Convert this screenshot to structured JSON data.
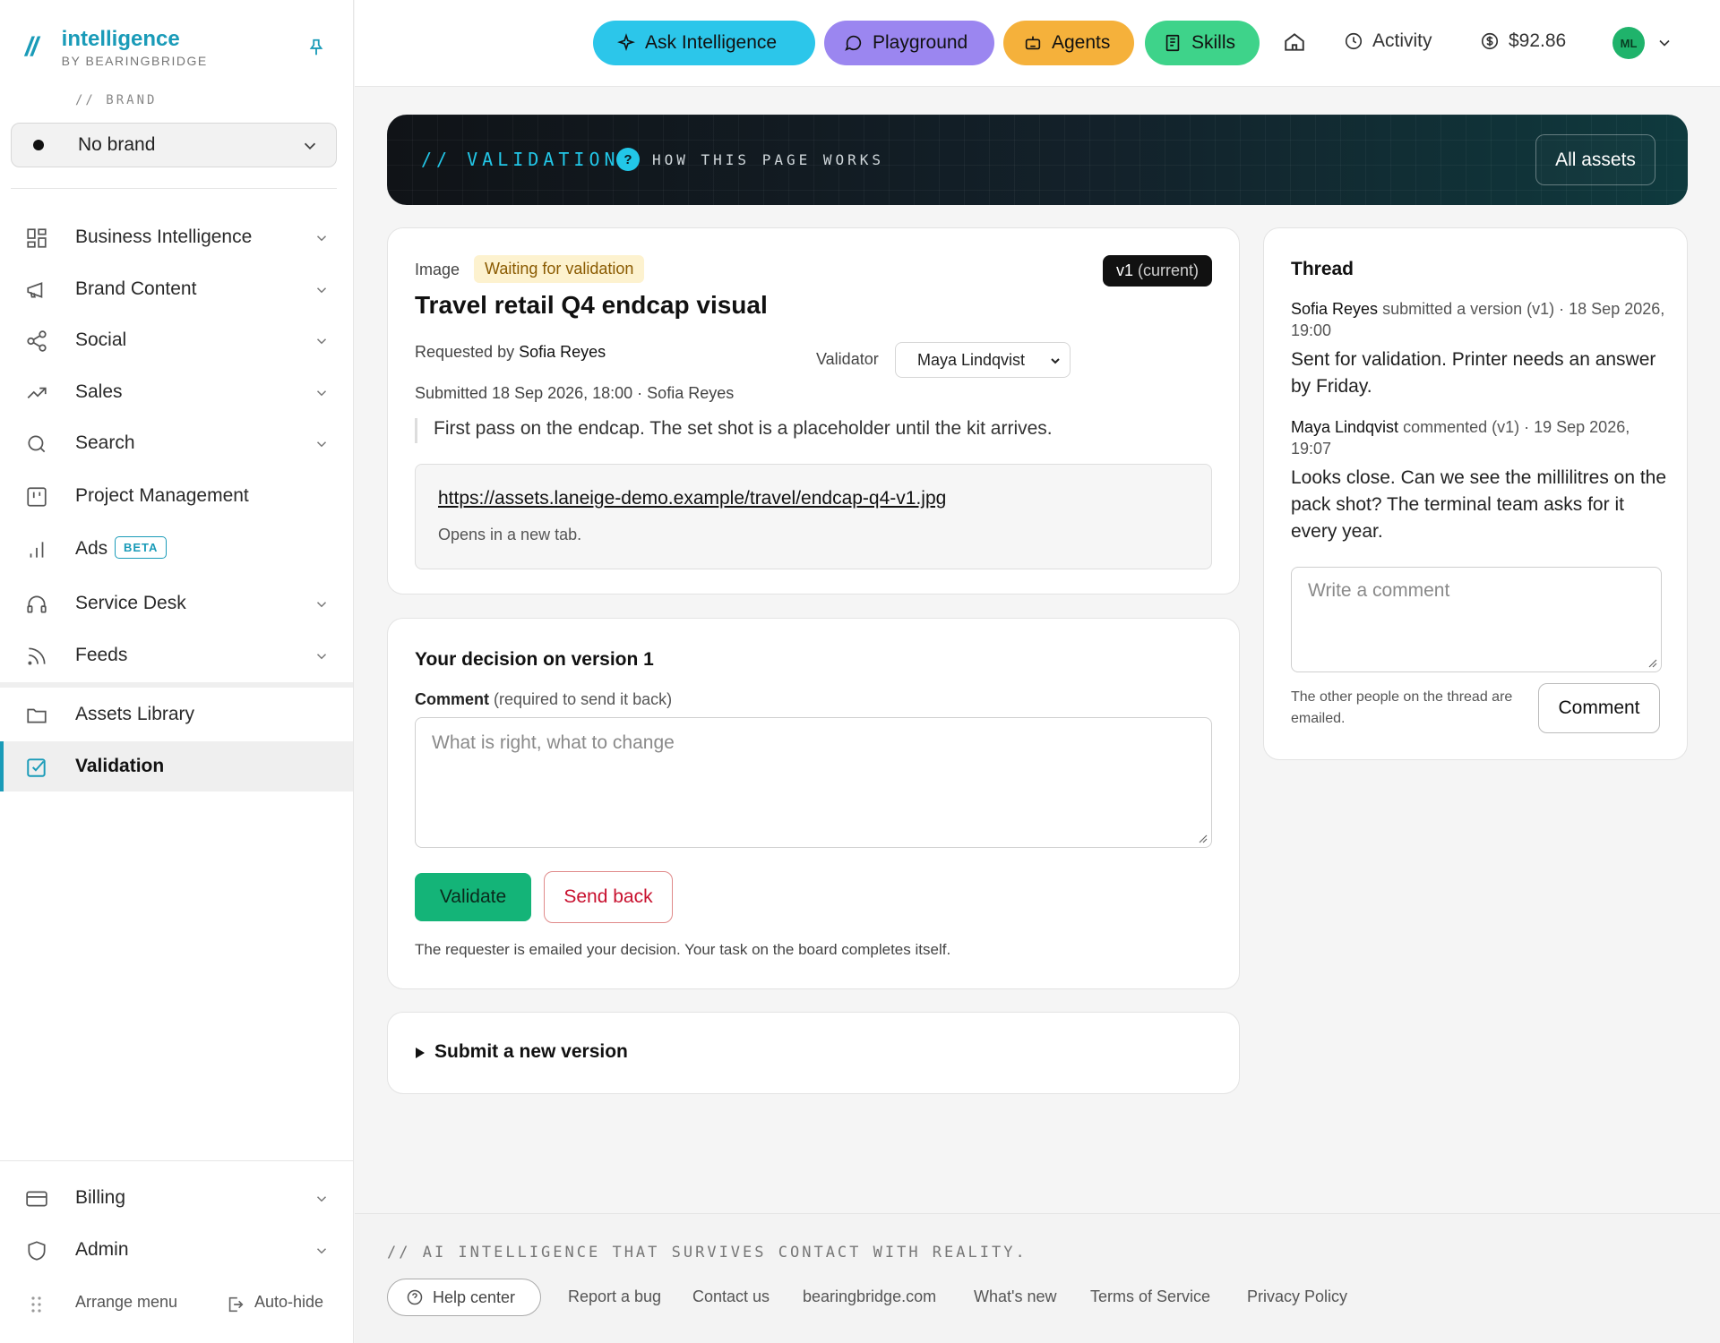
{
  "sidebar": {
    "logo_mark": "//",
    "app_name": "intelligence",
    "app_sub": "BY BEARINGBRIDGE",
    "brand_label": "// BRAND",
    "brand_value": "No brand",
    "items": [
      {
        "label": "Business Intelligence"
      },
      {
        "label": "Brand Content"
      },
      {
        "label": "Social"
      },
      {
        "label": "Sales"
      },
      {
        "label": "Search"
      },
      {
        "label": "Project Management"
      },
      {
        "label": "Ads",
        "badge": "BETA"
      },
      {
        "label": "Service Desk"
      },
      {
        "label": "Feeds"
      },
      {
        "label": "Assets Library"
      },
      {
        "label": "Validation"
      }
    ],
    "bottom": [
      {
        "label": "Billing"
      },
      {
        "label": "Admin"
      }
    ],
    "arrange_label": "Arrange menu",
    "autohide_label": "Auto-hide"
  },
  "topbar": {
    "ask": "Ask Intelligence",
    "playground": "Playground",
    "agents": "Agents",
    "skills": "Skills",
    "activity": "Activity",
    "balance": "$92.86",
    "avatar": "ML",
    "colors": {
      "ask": "#2cc6ea",
      "playground": "#9b86f0",
      "agents": "#f5b13b",
      "skills": "#3ed38a"
    }
  },
  "hero": {
    "title": "// VALIDATION",
    "help": "HOW THIS PAGE WORKS",
    "all_assets": "All assets"
  },
  "asset": {
    "type": "Image",
    "status": "Waiting for validation",
    "version": "v1",
    "version_suffix": "(current)",
    "title": "Travel retail Q4 endcap visual",
    "requested_prefix": "Requested by",
    "requested_by": "Sofia Reyes",
    "validator_label": "Validator",
    "validator": "Maya Lindqvist",
    "submitted": "Submitted 18 Sep 2026, 18:00 · Sofia Reyes",
    "note": "First pass on the endcap. The set shot is a placeholder until the kit arrives.",
    "url": "https://assets.laneige-demo.example/travel/endcap-q4-v1.jpg",
    "url_hint": "Opens in a new tab."
  },
  "decision": {
    "title": "Your decision on version 1",
    "comment_label": "Comment",
    "comment_required": "(required to send it back)",
    "placeholder": "What is right, what to change",
    "validate": "Validate",
    "send_back": "Send back",
    "note": "The requester is emailed your decision. Your task on the board completes itself."
  },
  "submit_new": "Submit a new version",
  "thread": {
    "title": "Thread",
    "entries": [
      {
        "author": "Sofia Reyes",
        "action": "submitted a version (v1) · 18 Sep 2026, 19:00",
        "body": "Sent for validation. Printer needs an answer by Friday."
      },
      {
        "author": "Maya Lindqvist",
        "action": "commented (v1) · 19 Sep 2026, 19:07",
        "body": "Looks close. Can we see the millilitres on the pack shot? The terminal team asks for it every year."
      }
    ],
    "placeholder": "Write a comment",
    "note": "The other people on the thread are emailed.",
    "comment_button": "Comment"
  },
  "footer": {
    "tagline": "// AI INTELLIGENCE THAT SURVIVES CONTACT WITH REALITY.",
    "help": "Help center",
    "links": [
      "Report a bug",
      "Contact us",
      "bearingbridge.com",
      "What's new",
      "Terms of Service",
      "Privacy Policy"
    ]
  }
}
